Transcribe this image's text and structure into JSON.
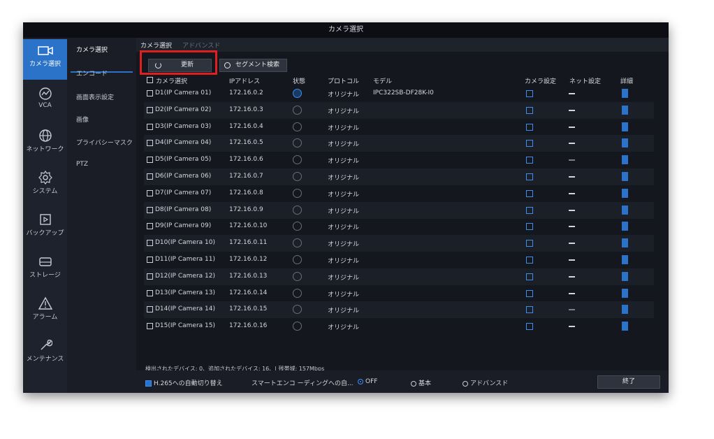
{
  "window_title": "カメラ選択",
  "left_nav": [
    {
      "label": "カメラ選択",
      "icon": "camera-icon",
      "active": true
    },
    {
      "label": "VCA",
      "icon": "vca-icon"
    },
    {
      "label": "ネットワーク",
      "icon": "globe-icon"
    },
    {
      "label": "システム",
      "icon": "gear-icon"
    },
    {
      "label": "バックアップ",
      "icon": "backup-icon"
    },
    {
      "label": "ストレージ",
      "icon": "storage-icon"
    },
    {
      "label": "アラーム",
      "icon": "alarm-icon"
    },
    {
      "label": "メンテナンス",
      "icon": "wrench-icon"
    }
  ],
  "sub_nav": [
    "カメラ選択",
    "エンコード",
    "画面表示設定",
    "画像",
    "プライバシーマスク",
    "PTZ"
  ],
  "tabs": [
    "カメラ選択",
    "アドバンスド"
  ],
  "toolbar": {
    "refresh_label": "更新",
    "segment_search_label": "セグメント検索"
  },
  "columns": [
    "カメラ選択",
    "IPアドレス",
    "状態",
    "プロトコル",
    "モデル",
    "カメラ設定",
    "ネット設定",
    "詳細"
  ],
  "rows": [
    {
      "name": "D1(IP Camera 01)",
      "ip": "172.16.0.2",
      "protocol": "オリジナル",
      "model": "IPC322SB-DF28K-I0"
    },
    {
      "name": "D2(IP Camera 02)",
      "ip": "172.16.0.3",
      "protocol": "オリジナル",
      "model": ""
    },
    {
      "name": "D3(IP Camera 03)",
      "ip": "172.16.0.4",
      "protocol": "オリジナル",
      "model": ""
    },
    {
      "name": "D4(IP Camera 04)",
      "ip": "172.16.0.5",
      "protocol": "オリジナル",
      "model": ""
    },
    {
      "name": "D5(IP Camera 05)",
      "ip": "172.16.0.6",
      "protocol": "オリジナル",
      "model": ""
    },
    {
      "name": "D6(IP Camera 06)",
      "ip": "172.16.0.7",
      "protocol": "オリジナル",
      "model": ""
    },
    {
      "name": "D7(IP Camera 07)",
      "ip": "172.16.0.8",
      "protocol": "オリジナル",
      "model": ""
    },
    {
      "name": "D8(IP Camera 08)",
      "ip": "172.16.0.9",
      "protocol": "オリジナル",
      "model": ""
    },
    {
      "name": "D9(IP Camera 09)",
      "ip": "172.16.0.10",
      "protocol": "オリジナル",
      "model": ""
    },
    {
      "name": "D10(IP Camera 10)",
      "ip": "172.16.0.11",
      "protocol": "オリジナル",
      "model": ""
    },
    {
      "name": "D11(IP Camera 11)",
      "ip": "172.16.0.12",
      "protocol": "オリジナル",
      "model": ""
    },
    {
      "name": "D12(IP Camera 12)",
      "ip": "172.16.0.13",
      "protocol": "オリジナル",
      "model": ""
    },
    {
      "name": "D13(IP Camera 13)",
      "ip": "172.16.0.14",
      "protocol": "オリジナル",
      "model": ""
    },
    {
      "name": "D14(IP Camera 14)",
      "ip": "172.16.0.15",
      "protocol": "オリジナル",
      "model": ""
    },
    {
      "name": "D15(IP Camera 15)",
      "ip": "172.16.0.16",
      "protocol": "オリジナル",
      "model": ""
    }
  ],
  "status_text": "検出されたデバイス: 0、追加されたデバイス: 16、| 残帯域: 157Mbps",
  "bottom": {
    "h265_label": "H.265への自動切り替え",
    "smart_label": "スマートエンコ ーディングへの自...",
    "opt_off": "OFF",
    "opt_basic": "基本",
    "opt_advanced": "アドバンスド",
    "exit_label": "終了"
  },
  "colors": {
    "accent": "#2a73c8",
    "highlight_box": "#e02020",
    "background": "#15181f"
  }
}
